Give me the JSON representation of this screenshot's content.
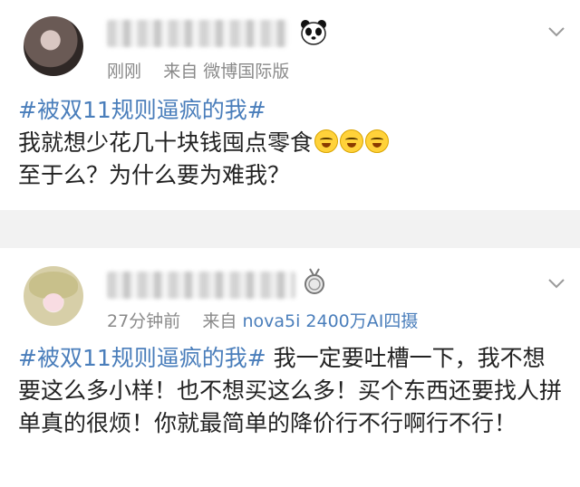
{
  "post1": {
    "meta_time": "刚刚",
    "meta_from": "来自",
    "meta_client": "微博国际版",
    "hashtag": "#被双11规则逼疯的我#",
    "line1": "我就想少花几十块钱囤点零食",
    "line2": "至于么？为什么要为难我？",
    "emoji_count": 3,
    "badge_icon": "panda-icon",
    "menu_icon": "chevron-down-icon"
  },
  "post2": {
    "meta_time": "27分钟前",
    "meta_from": "来自",
    "meta_client": "nova5i 2400万AI四摄",
    "hashtag": "#被双11规则逼疯的我#",
    "text": " 我一定要吐槽一下，我不想要这么多小样！也不想买这么多！买个东西还要找人拼单真的很烦！你就最简单的降价行不行啊行不行！",
    "badge_icon": "medal-icon",
    "menu_icon": "chevron-down-icon"
  },
  "colors": {
    "link": "#4a7ebb",
    "text": "#222222",
    "meta": "#8a8a8a",
    "separator": "#f2f2f2"
  }
}
